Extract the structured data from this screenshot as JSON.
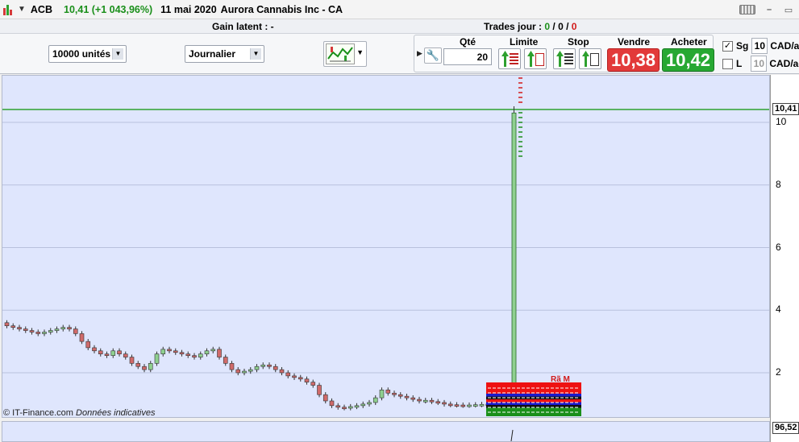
{
  "titlebar": {
    "ticker": "ACB",
    "quote": "10,41 (+1 043,96%)",
    "date": "11 mai 2020",
    "name": "Aurora Cannabis Inc - CA"
  },
  "status": {
    "gain_label": "Gain latent : -",
    "trades_label": "Trades jour : ",
    "trades_a": "0",
    "sep1": " / ",
    "trades_b": "0",
    "sep2": " / ",
    "trades_c": "0"
  },
  "toolbar": {
    "units_value": "10000 unités",
    "period_value": "Journalier",
    "qty_label": "Qté",
    "qty_value": "20",
    "limit_label": "Limite",
    "stop_label": "Stop",
    "sell_label": "Vendre",
    "buy_label": "Acheter",
    "sell_price": "10,38",
    "buy_price": "10,42",
    "sg_label": "Sg",
    "sg_value": "10",
    "sg_unit": "CAD/ac",
    "l_label": "L",
    "l_value": "10",
    "l_unit": "CAD/ac"
  },
  "chart": {
    "last_price_tag": "10,41",
    "lower_pane_tag": "96,52",
    "credit": "© IT-Finance.com",
    "credit_note": "Données indicatives",
    "tick_labels": [
      "10",
      "8",
      "6",
      "4",
      "2"
    ],
    "overlay_text": "Rã M",
    "colors": {
      "up": "#8fd08f",
      "down": "#d06a6a",
      "bg": "#dfe6fd",
      "last_line": "#2ea02e"
    }
  },
  "chart_data": {
    "type": "candlestick",
    "ylim": [
      0,
      11
    ],
    "yticks": [
      2,
      4,
      6,
      8,
      10
    ],
    "last_price": 10.41,
    "spike": {
      "open": 1.0,
      "close": 10.3,
      "high": 10.41,
      "low": 1.0
    },
    "closes": [
      3.5,
      3.45,
      3.4,
      3.35,
      3.3,
      3.25,
      3.3,
      3.35,
      3.4,
      3.45,
      3.4,
      3.25,
      3.0,
      2.8,
      2.7,
      2.6,
      2.55,
      2.7,
      2.6,
      2.5,
      2.3,
      2.2,
      2.1,
      2.3,
      2.6,
      2.75,
      2.7,
      2.65,
      2.6,
      2.55,
      2.5,
      2.6,
      2.7,
      2.75,
      2.5,
      2.3,
      2.1,
      2.0,
      2.05,
      2.1,
      2.2,
      2.25,
      2.2,
      2.1,
      2.0,
      1.9,
      1.85,
      1.8,
      1.7,
      1.6,
      1.3,
      1.1,
      0.95,
      0.9,
      0.88,
      0.92,
      0.95,
      1.0,
      1.05,
      1.2,
      1.45,
      1.35,
      1.3,
      1.25,
      1.2,
      1.15,
      1.1,
      1.12,
      1.08,
      1.05,
      1.0,
      0.98,
      0.97,
      0.96,
      0.97,
      0.98,
      0.99,
      1.0
    ]
  }
}
